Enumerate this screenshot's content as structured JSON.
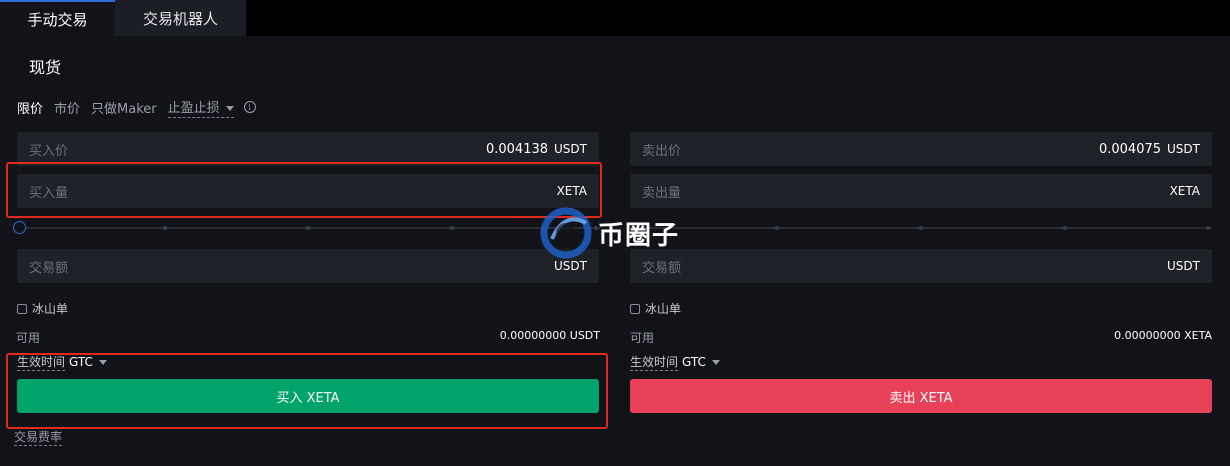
{
  "tabs": [
    {
      "label": "手动交易",
      "active": true
    },
    {
      "label": "交易机器人",
      "active": false
    }
  ],
  "section_title": "现货",
  "order_types": [
    {
      "label": "限价",
      "active": true
    },
    {
      "label": "市价",
      "active": false
    },
    {
      "label": "只做Maker",
      "active": false
    },
    {
      "label": "止盈止损",
      "active": false
    }
  ],
  "info_icon_glyph": "i",
  "buy": {
    "price_label": "买入价",
    "price_value": "0.004138",
    "price_unit": "USDT",
    "amount_placeholder": "买入量",
    "amount_unit": "XETA",
    "total_placeholder": "交易额",
    "total_unit": "USDT",
    "iceberg_label": "冰山单",
    "available_label": "可用",
    "available_value": "0.00000000 USDT",
    "tif_label": "生效时间",
    "tif_value": "GTC",
    "button_label": "买入 XETA"
  },
  "sell": {
    "price_label": "卖出价",
    "price_value": "0.004075",
    "price_unit": "USDT",
    "amount_placeholder": "卖出量",
    "amount_unit": "XETA",
    "total_placeholder": "交易额",
    "total_unit": "USDT",
    "iceberg_label": "冰山单",
    "available_label": "可用",
    "available_value": "0.00000000 XETA",
    "tif_label": "生效时间",
    "tif_value": "GTC",
    "button_label": "卖出 XETA"
  },
  "fee_label": "交易费率",
  "watermark_text": "币圈子",
  "colors": {
    "buy": "#00a36a",
    "sell": "#e64156",
    "accent": "#2e6bd6",
    "highlight": "#e02a20"
  },
  "icons": {
    "info": "info-circle-icon",
    "dropdown": "caret-down-icon",
    "watermark_logo": "coin-logo-icon"
  }
}
